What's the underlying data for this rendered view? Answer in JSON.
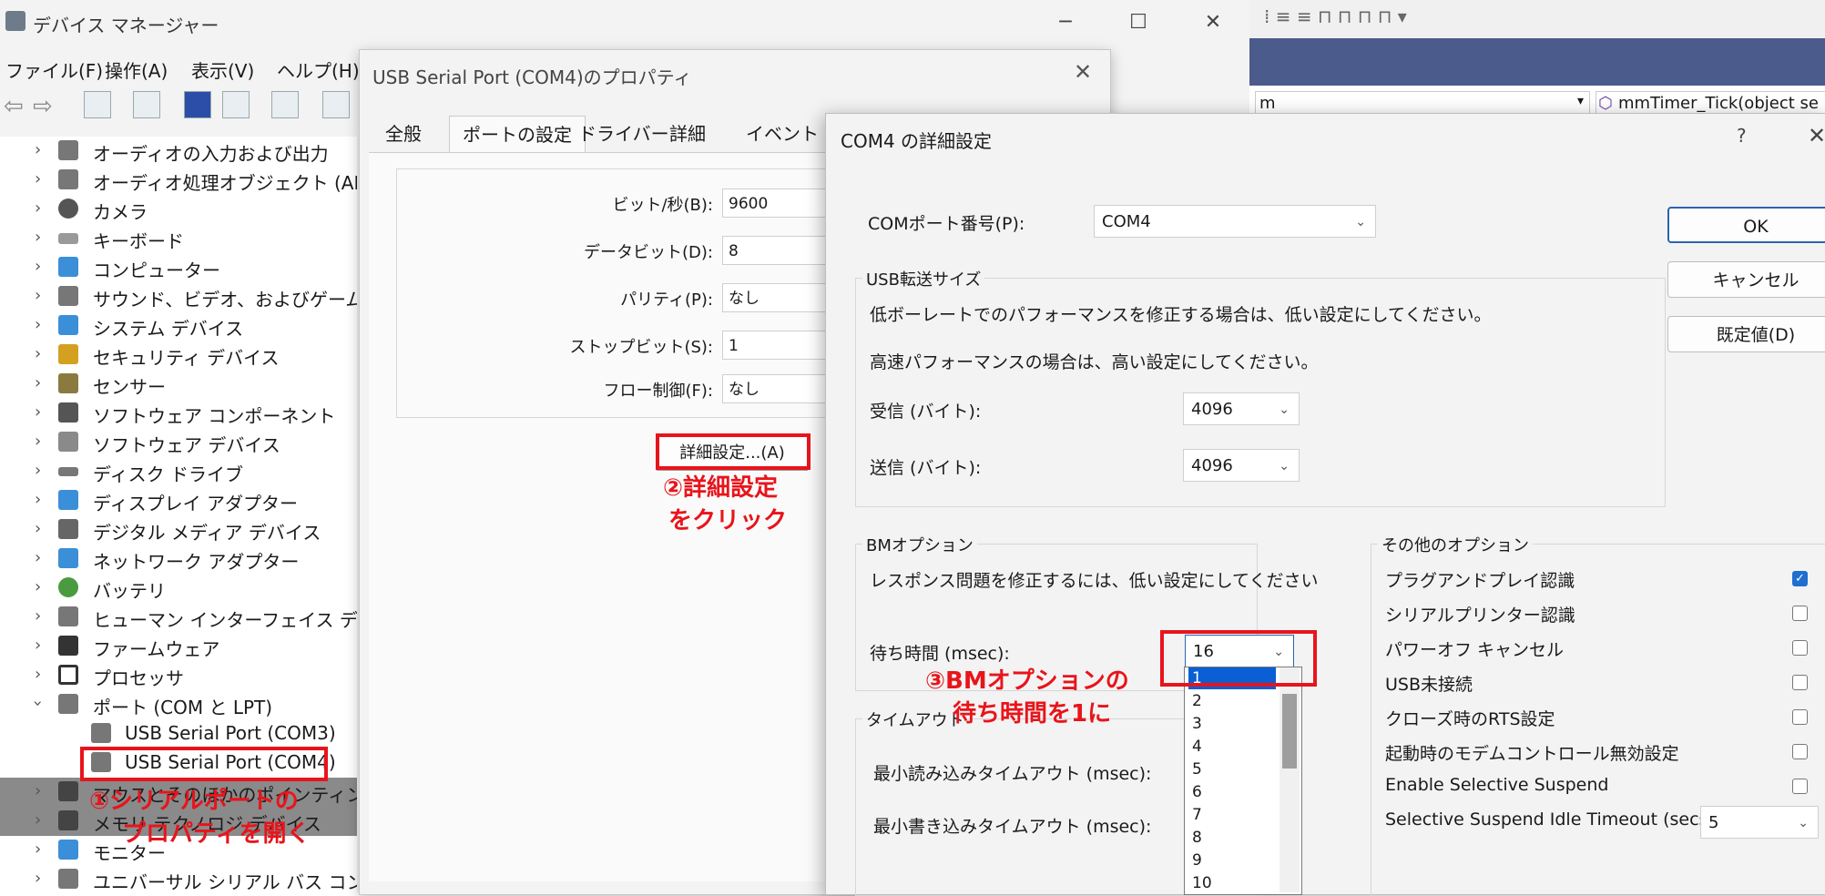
{
  "device_manager": {
    "title": "デバイス マネージャー",
    "menu": [
      "ファイル(F)",
      "操作(A)",
      "表示(V)",
      "ヘルプ(H)"
    ],
    "tree": [
      "オーディオの入力および出力",
      "オーディオ処理オブジェクト (APO)",
      "カメラ",
      "キーボード",
      "コンピューター",
      "サウンド、ビデオ、およびゲーム コントロ",
      "システム デバイス",
      "セキュリティ デバイス",
      "センサー",
      "ソフトウェア コンポーネント",
      "ソフトウェア デバイス",
      "ディスク ドライブ",
      "ディスプレイ アダプター",
      "デジタル メディア デバイス",
      "ネットワーク アダプター",
      "バッテリ",
      "ヒューマン インターフェイス デバイス",
      "ファームウェア",
      "プロセッサ",
      "ポート (COM と LPT)"
    ],
    "ports": [
      "USB Serial Port (COM3)",
      "USB Serial Port (COM4)"
    ],
    "tree_after": [
      "マウスとそのほかのポインティング デバ",
      "メモリ テクノロジ デバイス",
      "モニター",
      "ユニバーサル シリアル バス コントローラー"
    ]
  },
  "vs_background": {
    "dropdown_text_left": "m",
    "dropdown_text_right": "mmTimer_Tick(object se"
  },
  "properties": {
    "title": "USB Serial Port (COM4)のプロパティ",
    "tabs": [
      "全般",
      "ポートの設定",
      "ドライバー",
      "詳細",
      "イベント"
    ],
    "rows": [
      {
        "label": "ビット/秒(B):",
        "value": "9600"
      },
      {
        "label": "データビット(D):",
        "value": "8"
      },
      {
        "label": "パリティ(P):",
        "value": "なし"
      },
      {
        "label": "ストップビット(S):",
        "value": "1"
      },
      {
        "label": "フロー制御(F):",
        "value": "なし"
      }
    ],
    "advanced_button": "詳細設定...(A)"
  },
  "advanced": {
    "title": "COM4 の詳細設定",
    "help": "?",
    "com_port_label": "COMポート番号(P):",
    "com_port_value": "COM4",
    "usb_group": "USB転送サイズ",
    "usb_text1": "低ボーレートでのパフォーマンスを修正する場合は、低い設定にしてください。",
    "usb_text2": "高速パフォーマンスの場合は、高い設定にしてください。",
    "receive_label": "受信 (バイト):",
    "receive_value": "4096",
    "send_label": "送信 (バイト):",
    "send_value": "4096",
    "bm_group": "BMオプション",
    "bm_text": "レスポンス問題を修正するには、低い設定にしてください",
    "latency_label": "待ち時間 (msec):",
    "latency_value": "16",
    "timeout_group": "タイムアウト",
    "min_read_label": "最小読み込みタイムアウト (msec):",
    "min_write_label": "最小書き込みタイムアウト (msec):",
    "other_group": "その他のオプション",
    "options": [
      {
        "label": "プラグアンドプレイ認識",
        "checked": true
      },
      {
        "label": "シリアルプリンター認識",
        "checked": false
      },
      {
        "label": "パワーオフ キャンセル",
        "checked": false
      },
      {
        "label": "USB未接続",
        "checked": false
      },
      {
        "label": "クローズ時のRTS設定",
        "checked": false
      },
      {
        "label": "起動時のモデムコントロール無効設定",
        "checked": false
      },
      {
        "label": "Enable Selective Suspend",
        "checked": false
      }
    ],
    "idle_label": "Selective Suspend Idle Timeout (secs):",
    "idle_value": "5",
    "ok": "OK",
    "cancel": "キャンセル",
    "defaults": "既定値(D)",
    "latency_options": [
      "1",
      "2",
      "3",
      "4",
      "5",
      "6",
      "7",
      "8",
      "9",
      "10"
    ]
  },
  "annotations": {
    "step1_line1": "①シリアルポートの",
    "step1_line2": "プロパティを開く",
    "step2_line1": "②詳細設定",
    "step2_line2": "をクリック",
    "step3_line1": "③BMオプションの",
    "step3_line2": "待ち時間を1に"
  },
  "colors": {
    "annotation": "#e8141b",
    "selected": "#0a5fd4",
    "vs_band": "#4a5b8c"
  }
}
